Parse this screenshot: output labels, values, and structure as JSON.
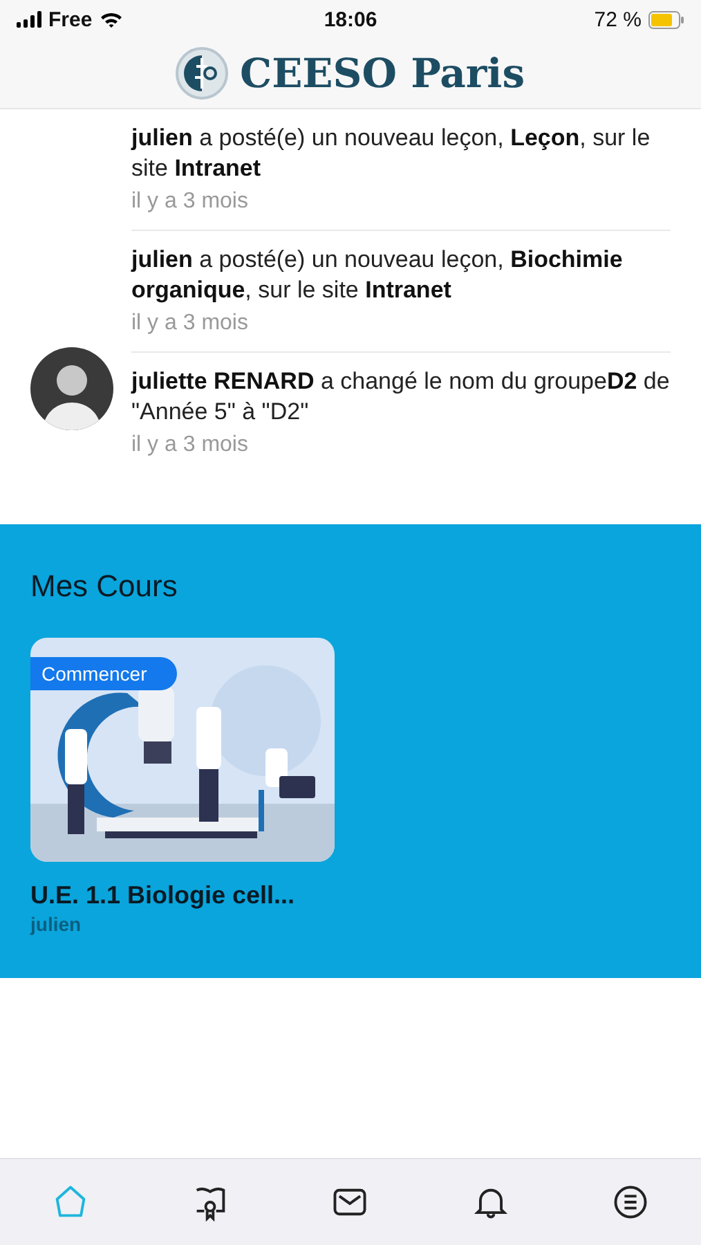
{
  "status_bar": {
    "carrier": "Free",
    "time": "18:06",
    "battery": "72 %"
  },
  "header": {
    "title": "CEESO Paris"
  },
  "feed": [
    {
      "text": "**julien** a posté(e) un nouveau leçon, **Leçon**, sur le site **Intranet**",
      "time": "il y a 3 mois",
      "avatar": false
    },
    {
      "text": "**julien** a posté(e) un nouveau leçon, **Biochimie organique**, sur le site **Intranet**",
      "time": "il y a 3 mois",
      "avatar": false
    },
    {
      "text": "**juliette RENARD** a changé le nom du groupe**D2** de \"Année 5\" à \"D2\"",
      "time": "il y a 3 mois",
      "avatar": true
    }
  ],
  "courses": {
    "heading": "Mes Cours",
    "items": [
      {
        "badge": "Commencer",
        "title": "U.E. 1.1 Biologie cell...",
        "author": "julien"
      }
    ]
  },
  "tab_bar": [
    {
      "kind": "home",
      "selected": true
    },
    {
      "kind": "certificate",
      "selected": false
    },
    {
      "kind": "mail",
      "selected": false
    },
    {
      "kind": "bell",
      "selected": false
    },
    {
      "kind": "list",
      "selected": false
    }
  ]
}
